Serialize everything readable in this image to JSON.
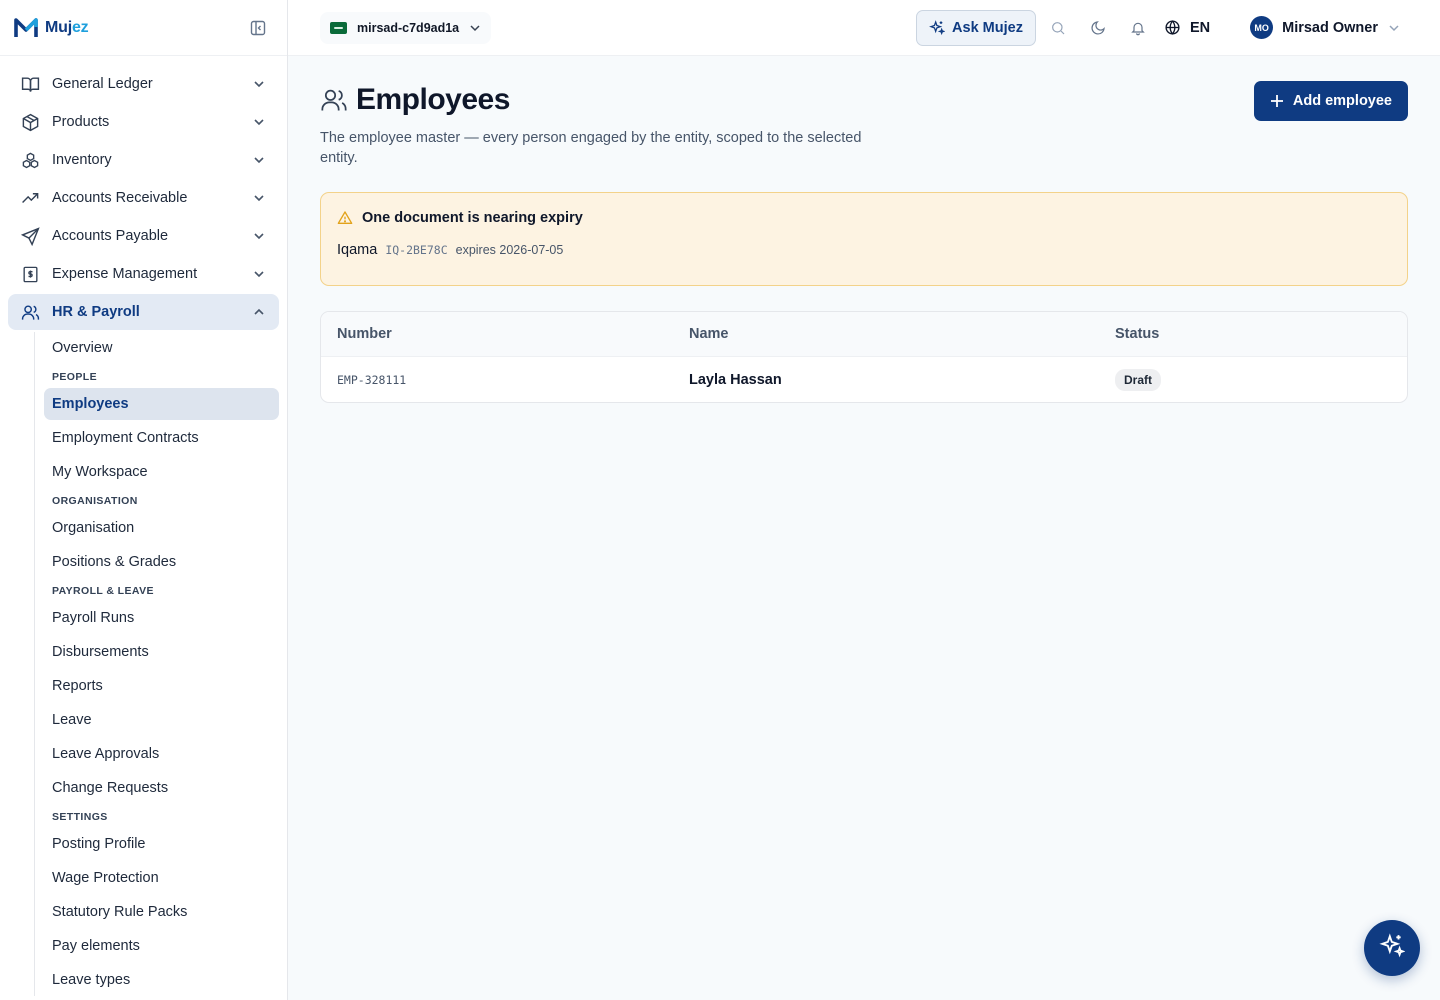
{
  "brand": {
    "name_part1": "Muj",
    "name_part2": "ez"
  },
  "sidebar": {
    "modules": [
      {
        "label": "General Ledger",
        "icon": "book-open-icon"
      },
      {
        "label": "Products",
        "icon": "package-icon"
      },
      {
        "label": "Inventory",
        "icon": "boxes-icon"
      },
      {
        "label": "Accounts Receivable",
        "icon": "trending-up-icon"
      },
      {
        "label": "Accounts Payable",
        "icon": "send-icon"
      },
      {
        "label": "Expense Management",
        "icon": "receipt-icon"
      }
    ],
    "active_module": {
      "label": "HR & Payroll",
      "icon": "users-icon"
    },
    "hr_sub": {
      "overview": "Overview",
      "people_heading": "PEOPLE",
      "employees": "Employees",
      "employment_contracts": "Employment Contracts",
      "my_workspace": "My Workspace",
      "organisation_heading": "ORGANISATION",
      "organisation": "Organisation",
      "positions_grades": "Positions & Grades",
      "payroll_leave_heading": "PAYROLL & LEAVE",
      "payroll_runs": "Payroll Runs",
      "disbursements": "Disbursements",
      "reports": "Reports",
      "leave": "Leave",
      "leave_approvals": "Leave Approvals",
      "change_requests": "Change Requests",
      "settings_heading": "SETTINGS",
      "posting_profile": "Posting Profile",
      "wage_protection": "Wage Protection",
      "statutory_rule_packs": "Statutory Rule Packs",
      "pay_elements": "Pay elements",
      "leave_types": "Leave types"
    }
  },
  "topbar": {
    "entity": "mirsad-c7d9ad1a",
    "ask_label": "Ask Mujez",
    "language": "EN",
    "user_initials": "MO",
    "user_name": "Mirsad Owner"
  },
  "page": {
    "title": "Employees",
    "description": "The employee master — every person engaged by the entity, scoped to the selected entity.",
    "add_button": "Add employee"
  },
  "alert": {
    "title": "One document is nearing expiry",
    "doc_type": "Iqama",
    "doc_number": "IQ-2BE78C",
    "expiry_text": "expires 2026-07-05"
  },
  "table": {
    "headers": {
      "number": "Number",
      "name": "Name",
      "status": "Status"
    },
    "rows": [
      {
        "number": "EMP-328111",
        "name": "Layla Hassan",
        "status": "Draft"
      }
    ]
  },
  "colors": {
    "primary": "#0f3b82",
    "accent": "#1fa0dd",
    "warning": "#e2a21a"
  }
}
